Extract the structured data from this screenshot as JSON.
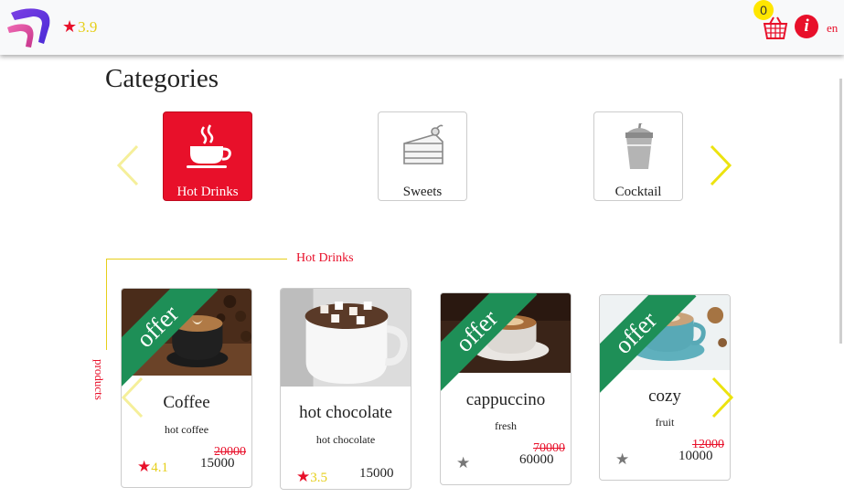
{
  "header": {
    "rating": "3.9",
    "cart_count": "0",
    "info_label": "i",
    "language": "en"
  },
  "categories": {
    "title": "Categories",
    "items": [
      {
        "label": "Hot Drinks",
        "icon": "hot-cup-icon",
        "active": true
      },
      {
        "label": "Sweets",
        "icon": "cake-icon",
        "active": false
      },
      {
        "label": "Cocktail",
        "icon": "cocktail-icon",
        "active": false
      }
    ]
  },
  "products": {
    "section_label": "Hot Drinks",
    "vertical_label": "products",
    "offer_label": "offer",
    "items": [
      {
        "name": "Coffee",
        "desc": "hot coffee",
        "rating": "4.1",
        "old_price": "20000",
        "price": "15000",
        "offer": true
      },
      {
        "name": "hot chocolate",
        "desc": "hot chocolate",
        "rating": "3.5",
        "old_price": "",
        "price": "15000",
        "offer": false
      },
      {
        "name": "cappuccino",
        "desc": "fresh",
        "rating": "",
        "old_price": "70000",
        "price": "60000",
        "offer": true
      },
      {
        "name": "cozy",
        "desc": "fruit",
        "rating": "",
        "old_price": "12000",
        "price": "10000",
        "offer": true
      }
    ]
  },
  "colors": {
    "accent_red": "#e8102a",
    "accent_yellow": "#e6cf1a",
    "offer_green": "#1e8f57"
  }
}
